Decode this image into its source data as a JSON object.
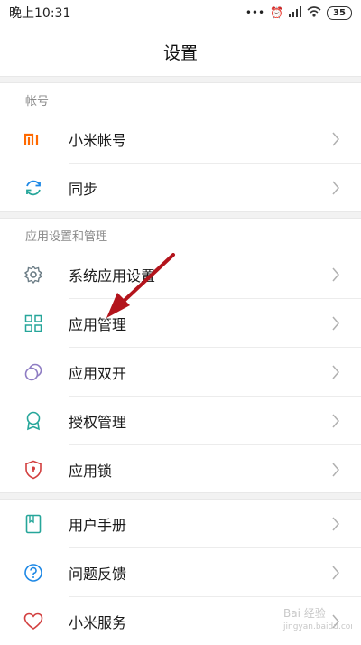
{
  "status_bar": {
    "time": "晚上10:31",
    "battery": "35"
  },
  "header": {
    "title": "设置"
  },
  "sections": {
    "account": {
      "title": "帐号",
      "items": [
        {
          "label": "小米帐号",
          "icon": "mi-logo-icon"
        },
        {
          "label": "同步",
          "icon": "sync-icon"
        }
      ]
    },
    "app_management": {
      "title": "应用设置和管理",
      "items": [
        {
          "label": "系统应用设置",
          "icon": "gear-icon"
        },
        {
          "label": "应用管理",
          "icon": "grid-icon"
        },
        {
          "label": "应用双开",
          "icon": "dual-circle-icon"
        },
        {
          "label": "授权管理",
          "icon": "badge-icon"
        },
        {
          "label": "应用锁",
          "icon": "shield-lock-icon"
        }
      ]
    },
    "support": {
      "items": [
        {
          "label": "用户手册",
          "icon": "book-icon"
        },
        {
          "label": "问题反馈",
          "icon": "question-icon"
        },
        {
          "label": "小米服务",
          "icon": "heart-icon"
        }
      ]
    }
  },
  "colors": {
    "mi_orange": "#ff6900",
    "sync_blue": "#1e88e5",
    "teal": "#26a69a",
    "purple": "#8e7cc3",
    "red_icon": "#d23f3f",
    "annotation_arrow": "#b3141c"
  }
}
